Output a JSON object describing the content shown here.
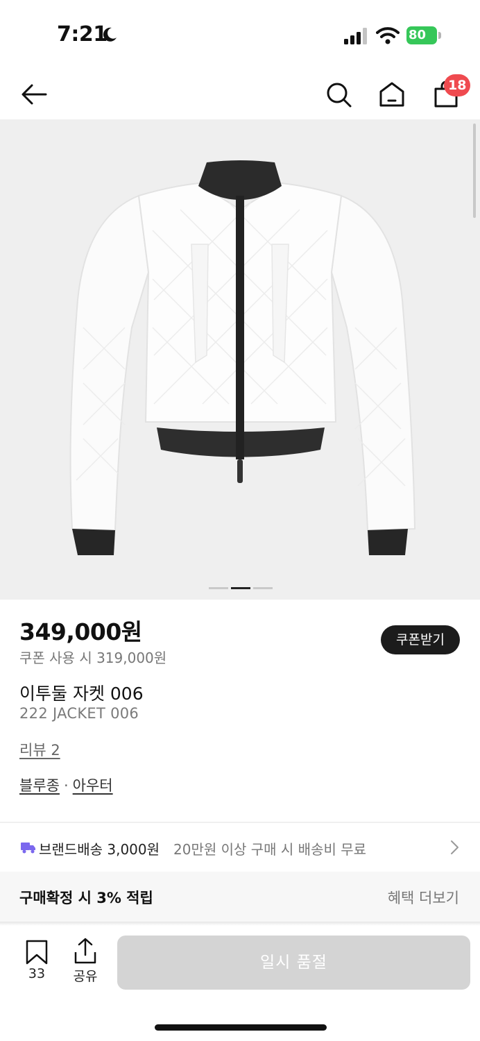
{
  "status_bar": {
    "time": "7:21",
    "battery_level": "80",
    "icons": [
      "moon-icon",
      "signal-icon",
      "wifi-icon",
      "battery-icon"
    ]
  },
  "nav": {
    "icons": [
      "back-arrow-icon",
      "search-icon",
      "home-icon",
      "shopping-bag-icon"
    ],
    "cart_count": "18"
  },
  "gallery": {
    "page_count": 3,
    "active_page": 2
  },
  "product": {
    "price": "349,000원",
    "coupon_price": "쿠폰 사용 시 319,000원",
    "coupon_button": "쿠폰받기",
    "name_ko": "이투둘 자켓 006",
    "name_en": "222 JACKET 006",
    "reviews": "리뷰 2",
    "categories": [
      "블루종",
      "아우터"
    ],
    "category_separator": "·"
  },
  "shipping": {
    "main": "브랜드배송 3,000원",
    "sub": "20만원 이상 구매 시 배송비 무료",
    "icon": "truck-icon"
  },
  "benefit": {
    "main": "구매확정 시 3% 적립",
    "more": "혜택 더보기"
  },
  "action_bar": {
    "bookmark_count": "33",
    "share_label": "공유",
    "soldout_label": "일시 품절"
  },
  "colors": {
    "badge": "#ef4a4f",
    "battery": "#36c759",
    "truck": "#7b68ee",
    "button_disabled": "#d4d4d4"
  }
}
